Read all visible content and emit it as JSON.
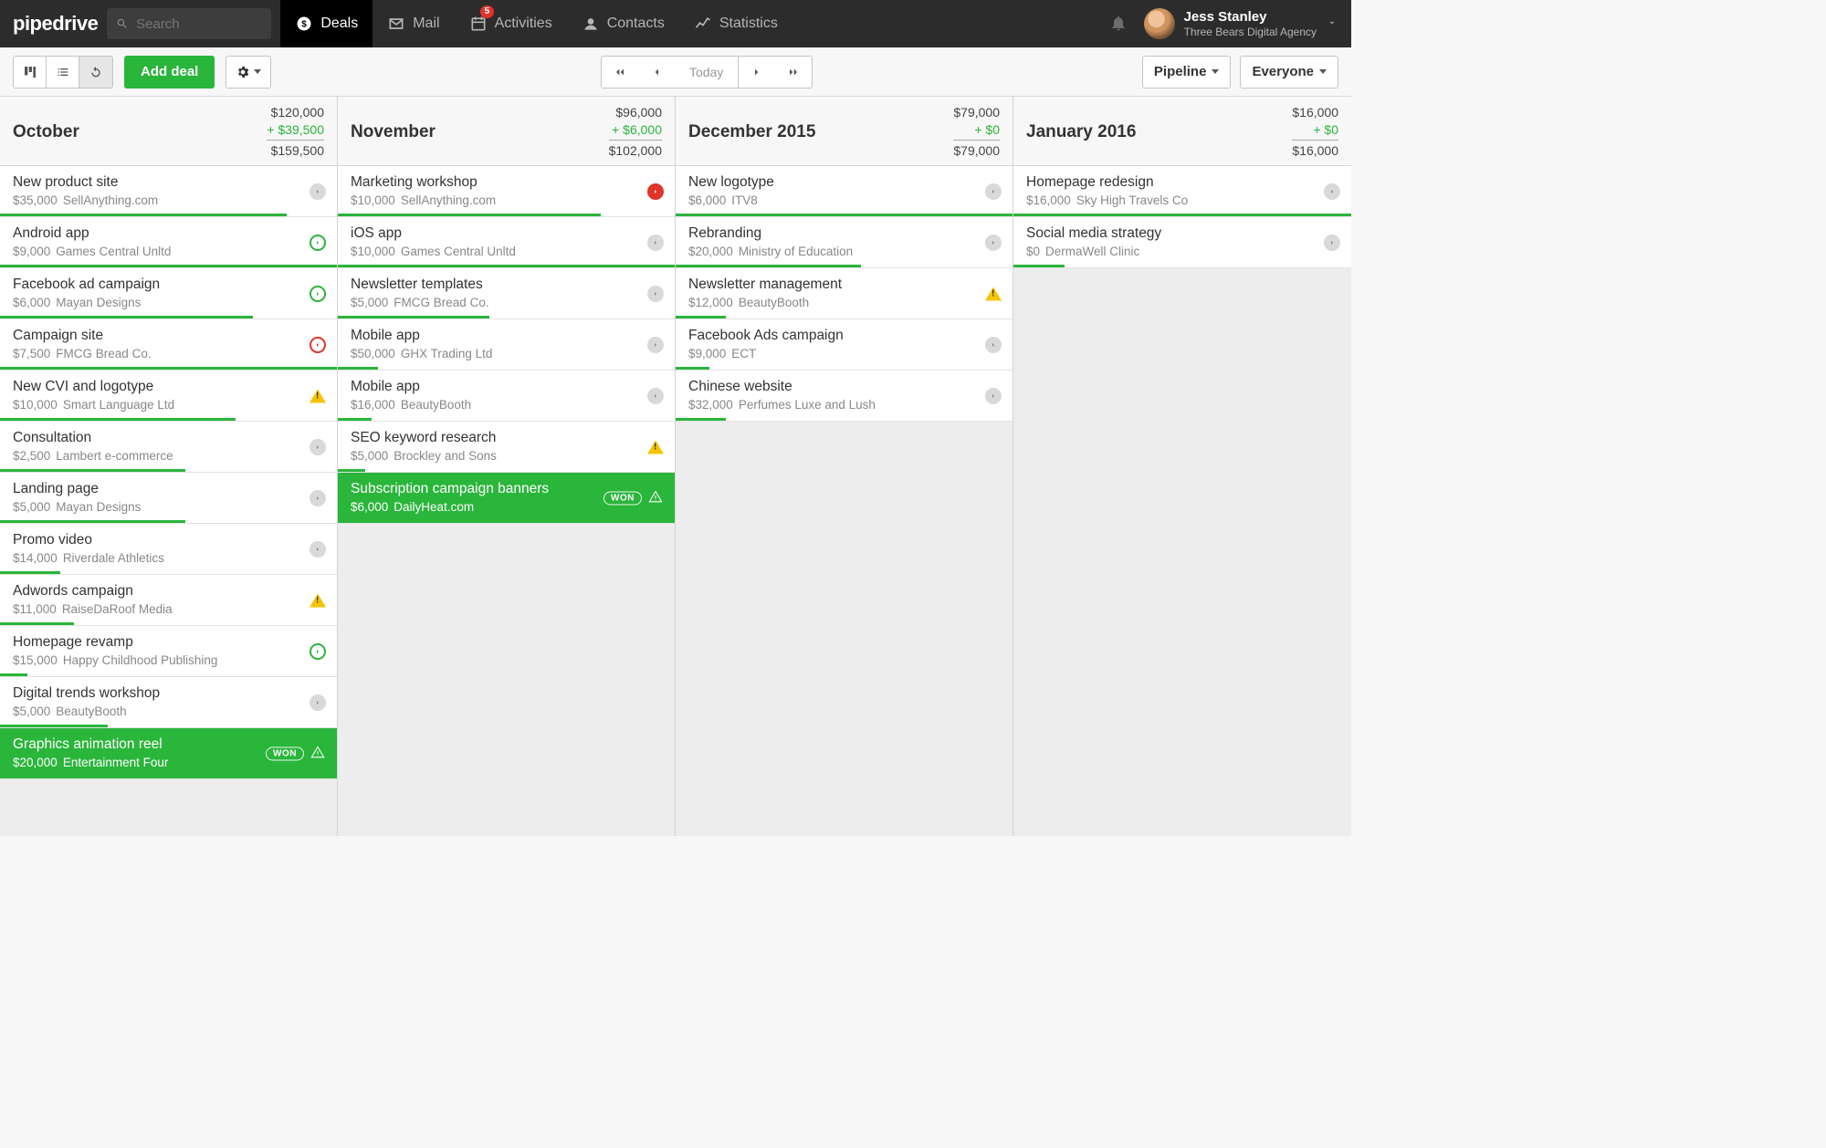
{
  "topbar": {
    "logo": "pipedrive",
    "search_placeholder": "Search",
    "nav": [
      {
        "id": "deals",
        "label": "Deals",
        "active": true
      },
      {
        "id": "mail",
        "label": "Mail"
      },
      {
        "id": "activities",
        "label": "Activities",
        "badge": "5"
      },
      {
        "id": "contacts",
        "label": "Contacts"
      },
      {
        "id": "statistics",
        "label": "Statistics"
      }
    ],
    "user": {
      "name": "Jess Stanley",
      "org": "Three Bears Digital Agency"
    }
  },
  "toolbar": {
    "add_deal": "Add deal",
    "today": "Today",
    "pipeline": "Pipeline",
    "everyone": "Everyone"
  },
  "columns": [
    {
      "title": "October",
      "base": "$120,000",
      "delta": "+ $39,500",
      "total": "$159,500",
      "cards": [
        {
          "title": "New product site",
          "amount": "$35,000",
          "org": "SellAnything.com",
          "status": "grey",
          "progress": 85
        },
        {
          "title": "Android app",
          "amount": "$9,000",
          "org": "Games Central Unltd",
          "status": "green",
          "progress": 100
        },
        {
          "title": "Facebook ad campaign",
          "amount": "$6,000",
          "org": "Mayan Designs",
          "status": "green",
          "progress": 75
        },
        {
          "title": "Campaign site",
          "amount": "$7,500",
          "org": "FMCG Bread Co.",
          "status": "red-o",
          "progress": 100
        },
        {
          "title": "New CVI and logotype",
          "amount": "$10,000",
          "org": "Smart Language Ltd",
          "warn": true,
          "progress": 70
        },
        {
          "title": "Consultation",
          "amount": "$2,500",
          "org": "Lambert e-commerce",
          "status": "grey",
          "progress": 55
        },
        {
          "title": "Landing page",
          "amount": "$5,000",
          "org": "Mayan Designs",
          "status": "grey",
          "progress": 55
        },
        {
          "title": "Promo video",
          "amount": "$14,000",
          "org": "Riverdale Athletics",
          "status": "grey",
          "progress": 18
        },
        {
          "title": "Adwords campaign",
          "amount": "$11,000",
          "org": "RaiseDaRoof Media",
          "warn": true,
          "progress": 22
        },
        {
          "title": "Homepage revamp",
          "amount": "$15,000",
          "org": "Happy Childhood Publishing",
          "status": "green",
          "progress": 8
        },
        {
          "title": "Digital trends workshop",
          "amount": "$5,000",
          "org": "BeautyBooth",
          "status": "grey",
          "progress": 32
        },
        {
          "title": "Graphics animation reel",
          "amount": "$20,000",
          "org": "Entertainment Four",
          "won": true
        }
      ]
    },
    {
      "title": "November",
      "base": "$96,000",
      "delta": "+ $6,000",
      "total": "$102,000",
      "cards": [
        {
          "title": "Marketing workshop",
          "amount": "$10,000",
          "org": "SellAnything.com",
          "status": "red",
          "progress": 78
        },
        {
          "title": "iOS app",
          "amount": "$10,000",
          "org": "Games Central Unltd",
          "status": "grey",
          "progress": 100
        },
        {
          "title": "Newsletter templates",
          "amount": "$5,000",
          "org": "FMCG Bread Co.",
          "status": "grey",
          "progress": 45
        },
        {
          "title": "Mobile app",
          "amount": "$50,000",
          "org": "GHX Trading Ltd",
          "status": "grey",
          "progress": 12
        },
        {
          "title": "Mobile app",
          "amount": "$16,000",
          "org": "BeautyBooth",
          "status": "grey",
          "progress": 10
        },
        {
          "title": "SEO keyword research",
          "amount": "$5,000",
          "org": "Brockley and Sons",
          "warn": true,
          "progress": 8
        },
        {
          "title": "Subscription campaign banners",
          "amount": "$6,000",
          "org": "DailyHeat.com",
          "won": true
        }
      ]
    },
    {
      "title": "December 2015",
      "base": "$79,000",
      "delta": "+ $0",
      "total": "$79,000",
      "cards": [
        {
          "title": "New logotype",
          "amount": "$6,000",
          "org": "ITV8",
          "status": "grey",
          "progress": 100
        },
        {
          "title": "Rebranding",
          "amount": "$20,000",
          "org": "Ministry of Education",
          "status": "grey",
          "progress": 55
        },
        {
          "title": "Newsletter management",
          "amount": "$12,000",
          "org": "BeautyBooth",
          "warn": true,
          "progress": 15
        },
        {
          "title": "Facebook Ads campaign",
          "amount": "$9,000",
          "org": "ECT",
          "status": "grey",
          "progress": 10
        },
        {
          "title": "Chinese website",
          "amount": "$32,000",
          "org": "Perfumes Luxe and Lush",
          "status": "grey",
          "progress": 15
        }
      ]
    },
    {
      "title": "January 2016",
      "base": "$16,000",
      "delta": "+ $0",
      "total": "$16,000",
      "cards": [
        {
          "title": "Homepage redesign",
          "amount": "$16,000",
          "org": "Sky High Travels Co",
          "status": "grey",
          "progress": 100
        },
        {
          "title": "Social media strategy",
          "amount": "$0",
          "org": "DermaWell Clinic",
          "status": "grey",
          "progress": 15
        }
      ]
    }
  ]
}
